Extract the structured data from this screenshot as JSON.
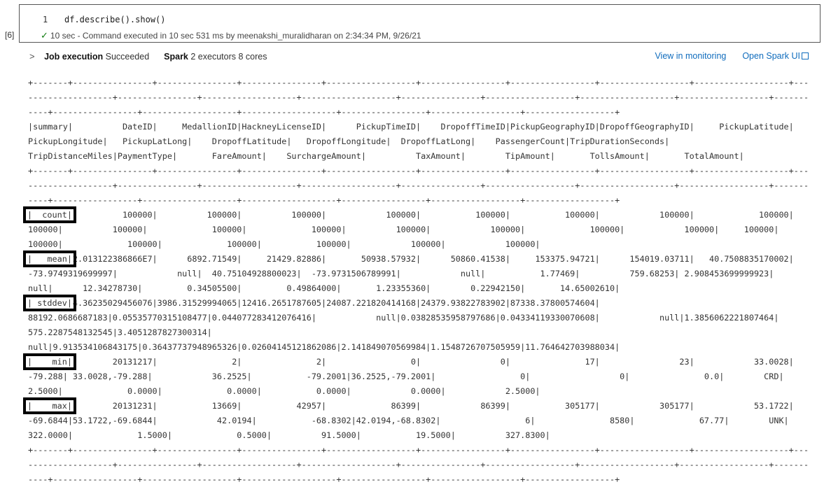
{
  "cell": {
    "execution_count": "[6]",
    "line_number": "1",
    "code": "df.describe().show()",
    "status_icon": "checkmark-icon",
    "status_text": "10 sec - Command executed in 10 sec 531 ms by meenakshi_muralidharan on 2:34:34 PM, 9/26/21"
  },
  "job": {
    "label": "Job execution",
    "state": "Succeeded",
    "spark_label": "Spark",
    "spark_info": "2 executors 8 cores",
    "view_monitoring": "View in monitoring",
    "open_spark_ui": "Open Spark UI"
  },
  "colors": {
    "link": "#0f6cbd",
    "success": "#107c10"
  },
  "table": {
    "columns": [
      "summary",
      "DateID",
      "MedallionID",
      "HackneyLicenseID",
      "PickupTimeID",
      "DropoffTimeID",
      "PickupGeographyID",
      "DropoffGeographyID",
      "PickupLatitude",
      "PickupLongitude",
      "PickupLatLong",
      "DropoffLatitude",
      "DropoffLongitude",
      "DropoffLatLong",
      "PassengerCount",
      "TripDurationSeconds",
      "TripDistanceMiles",
      "PaymentType",
      "FareAmount",
      "SurchargeAmount",
      "TaxAmount",
      "TipAmount",
      "TollsAmount",
      "TotalAmount"
    ],
    "rows": [
      [
        "count",
        "100000",
        "100000",
        "100000",
        "100000",
        "100000",
        "100000",
        "100000",
        "100000",
        "100000",
        "100000",
        "100000",
        "100000",
        "100000",
        "100000",
        "100000",
        "100000",
        "100000",
        "100000",
        "100000",
        "100000",
        "100000",
        "100000",
        "100000"
      ],
      [
        "mean",
        "2.013122386866E7",
        "6892.71549",
        "21429.82886",
        "50938.57932",
        "50860.41538",
        "153375.94721",
        "154019.03711",
        "40.7508835170002",
        "-73.9749319699997",
        "null",
        "40.75104928800023",
        "-73.9731506789991",
        "null",
        "1.77469",
        "759.68253",
        "2.908453699999923",
        "null",
        "12.34278730",
        "0.34505500",
        "0.49864000",
        "1.23355360",
        "0.22942150",
        "14.65002610"
      ],
      [
        "stddev",
        "4.36235029456076",
        "3986.31529994065",
        "12416.2651787605",
        "24087.221820414168",
        "24379.93822783902",
        "87338.37800574604",
        "88192.0686687183",
        "0.05535770315108477",
        "0.044077283412076416",
        "null",
        "0.03828535958797686",
        "0.04334119330070608",
        "null",
        "1.3856062221807464",
        "575.2287548132545",
        "3.4051287827300314",
        "null",
        "9.913534106843175",
        "0.36437737948965326",
        "0.02604145121862086",
        "2.141849070569984",
        "1.1548726707505959",
        "11.764642703988034"
      ],
      [
        "min",
        "20131217",
        "2",
        "2",
        "0",
        "0",
        "17",
        "23",
        "33.0028",
        "-79.288",
        "33.0028,-79.288",
        "36.2525",
        "-79.2001",
        "36.2525,-79.2001",
        "0",
        "0",
        "0.0",
        "CRD",
        "2.5000",
        "0.0000",
        "0.0000",
        "0.0000",
        "0.0000",
        "2.5000"
      ],
      [
        "max",
        "20131231",
        "13669",
        "42957",
        "86399",
        "86399",
        "305177",
        "305177",
        "53.1722",
        "-69.6844",
        "53.1722,-69.6844",
        "42.0194",
        "-68.8302",
        "42.0194,-68.8302",
        "6",
        "8580",
        "67.77",
        "UNK",
        "322.0000",
        "1.5000",
        "0.5000",
        "91.5000",
        "19.5000",
        "327.8300"
      ]
    ]
  }
}
